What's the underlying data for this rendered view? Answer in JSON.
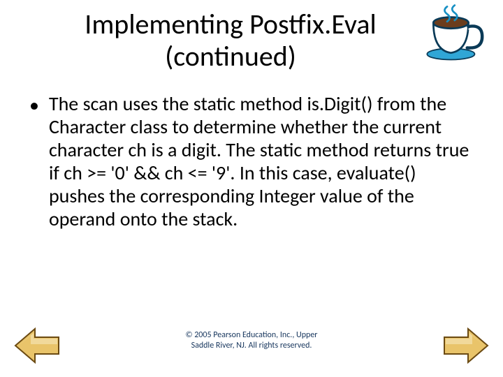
{
  "title": {
    "line1": "Implementing Postfix.Eval",
    "line2": "(continued)"
  },
  "body": {
    "bullet": "•",
    "text": "The scan uses the static method is.Digit() from the Character class to determine whether the current character ch is a digit. The static method returns true if ch >= '0' && ch <= '9'. In this case, evaluate() pushes the corresponding Integer value of the operand onto the stack."
  },
  "footer": {
    "line1": "© 2005 Pearson Education, Inc., Upper",
    "line2": "Saddle River, NJ. All rights reserved."
  },
  "icons": {
    "corner": "coffee-cup-icon",
    "prev": "prev-arrow-icon",
    "next": "next-arrow-icon"
  }
}
